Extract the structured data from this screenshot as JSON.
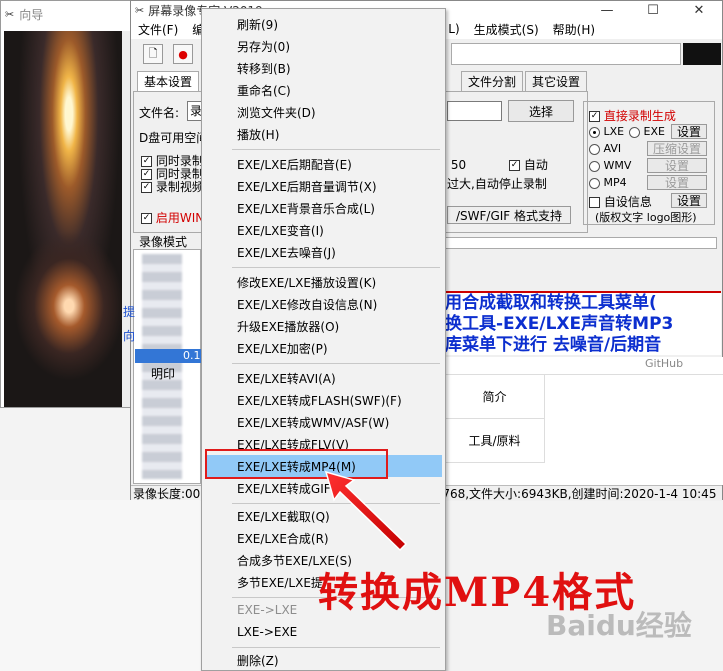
{
  "wizard": {
    "title": "向导"
  },
  "main": {
    "title": "屏幕录像专家 V2019",
    "menus": [
      "文件(F)",
      "编",
      "L)",
      "生成模式(S)",
      "帮助(H)"
    ],
    "tabs": [
      "基本设置",
      "文件分割",
      "其它设置"
    ],
    "file_name_label": "文件名:",
    "file_name_value": "录",
    "browse_button": "选择",
    "disk_label": "D盘可用空间",
    "chk_simul_1": "同时录制",
    "chk_simul_2": "同时录制",
    "chk_record_video": "录制视频",
    "chk_enable_win": "启用WIN",
    "fps_value": "50",
    "auto_label": "自动",
    "auto_stop": "过大,自动停止录制",
    "format_support": "/SWF/GIF  格式支持",
    "record_mode_label": "录像模式",
    "left_links": [
      "提",
      "向"
    ],
    "direct_generate": "直接录制生成",
    "format_options": [
      {
        "label": "LXE",
        "selected": true
      },
      {
        "label": "EXE",
        "selected": false
      },
      {
        "label": "AVI",
        "selected": false
      },
      {
        "label": "WMV",
        "selected": false
      },
      {
        "label": "MP4",
        "selected": false
      }
    ],
    "setting_buttons": [
      "设置",
      "压缩设置",
      "设置",
      "设置"
    ],
    "self_info": "自设信息",
    "self_info_button": "设置",
    "copyright_note": "(版权文字 logo图形)",
    "file_item": "0.1",
    "extra_item": "明印",
    "status_left": "录像长度:00",
    "status_right": "768,文件大小:6943KB,创建时间:2020-1-4 10:45",
    "banner_lines": [
      "用合成截取和转换工具菜单(",
      "换工具-EXE/LXE声音转MP3",
      "库菜单下进行 去噪音/后期音"
    ],
    "right_under": [
      "简介",
      "工具/原料"
    ],
    "right_browser": "GitHub"
  },
  "context_menu": {
    "items": [
      {
        "label": "刷新(9)",
        "disabled": false
      },
      {
        "label": "另存为(0)",
        "disabled": false
      },
      {
        "label": "转移到(B)",
        "disabled": false
      },
      {
        "label": "重命名(C)",
        "disabled": false
      },
      {
        "label": "浏览文件夹(D)",
        "disabled": false
      },
      {
        "label": "播放(H)",
        "disabled": false
      },
      {
        "label": "EXE/LXE后期配音(E)",
        "disabled": false
      },
      {
        "label": "EXE/LXE后期音量调节(X)",
        "disabled": false
      },
      {
        "label": "EXE/LXE背景音乐合成(L)",
        "disabled": false
      },
      {
        "label": "EXE/LXE变音(I)",
        "disabled": false
      },
      {
        "label": "EXE/LXE去噪音(J)",
        "disabled": false
      },
      {
        "label": "修改EXE/LXE播放设置(K)",
        "disabled": false
      },
      {
        "label": "EXE/LXE修改自设信息(N)",
        "disabled": false
      },
      {
        "label": "升级EXE播放器(O)",
        "disabled": false
      },
      {
        "label": "EXE/LXE加密(P)",
        "disabled": false
      },
      {
        "label": "EXE/LXE转AVI(A)",
        "disabled": false
      },
      {
        "label": "EXE/LXE转成FLASH(SWF)(F)",
        "disabled": false
      },
      {
        "label": "EXE/LXE转成WMV/ASF(W)",
        "disabled": false
      },
      {
        "label": "EXE/LXE转成FLV(V)",
        "disabled": false
      },
      {
        "label": "EXE/LXE转成MP4(M)",
        "disabled": false,
        "highlighted": true
      },
      {
        "label": "EXE/LXE转成GIF",
        "disabled": false
      },
      {
        "label": "EXE/LXE截取(Q)",
        "disabled": false
      },
      {
        "label": "EXE/LXE合成(R)",
        "disabled": false
      },
      {
        "label": "合成多节EXE/LXE(S)",
        "disabled": false
      },
      {
        "label": "多节EXE/LXE提",
        "disabled": false
      },
      {
        "label": "EXE->LXE",
        "disabled": true
      },
      {
        "label": "LXE->EXE",
        "disabled": false
      },
      {
        "label": "删除(Z)",
        "disabled": false
      }
    ]
  },
  "annotation": {
    "text": "转换成MP4格式"
  },
  "watermark": {
    "text": "Baidu经验"
  },
  "colors": {
    "highlight": "#91c9f7",
    "annotation_red": "#e01010",
    "banner_blue": "#0c2fcf"
  }
}
